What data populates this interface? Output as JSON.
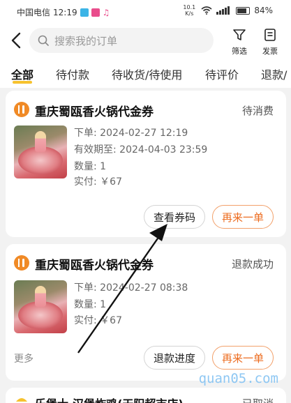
{
  "status_bar": {
    "carrier": "中国电信",
    "time": "12:19",
    "net_speed": "10.1 K/s",
    "battery": "84%",
    "icons": [
      "wechat-app-icon",
      "video-app-icon",
      "music-app-icon",
      "wifi-icon",
      "signal-icon",
      "battery-icon"
    ]
  },
  "header": {
    "search_placeholder": "搜索我的订单",
    "filter_label": "筛选",
    "invoice_label": "发票"
  },
  "tabs": [
    "全部",
    "待付款",
    "待收货/待使用",
    "待评价",
    "退款/"
  ],
  "active_tab": 0,
  "orders": [
    {
      "shop_name": "重庆蜀瓯香火锅代金券",
      "status": "待消费",
      "details": [
        "下单: 2024-02-27 12:19",
        "有效期至: 2024-04-03 23:59",
        "数量: 1",
        "实付: ￥67"
      ],
      "buttons": [
        "查看券码",
        "再来一单"
      ]
    },
    {
      "shop_name": "重庆蜀瓯香火锅代金券",
      "status": "退款成功",
      "details": [
        "下单: 2024-02-27 08:38",
        "数量: 1",
        "实付: ￥67"
      ],
      "more": "更多",
      "buttons": [
        "退款进度",
        "再来一单"
      ]
    },
    {
      "shop_name": "乐堡士·汉堡炸鸡(天阳超市店)",
      "status": "已取消"
    }
  ],
  "watermark": "quan05.com",
  "colors": {
    "accent": "#ec6b1e",
    "tab_underline": "#f6c22e",
    "shop_icon": "#f08a26",
    "watermark": "#8ec7f3"
  }
}
